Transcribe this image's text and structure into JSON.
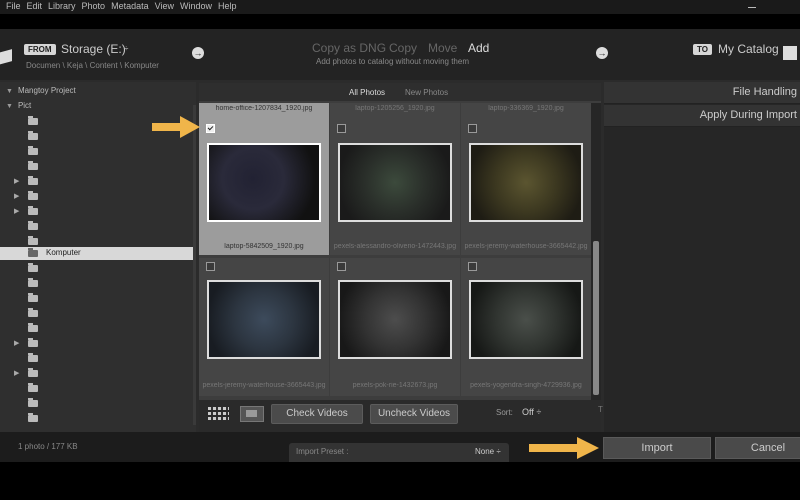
{
  "menu": [
    "File",
    "Edit",
    "Library",
    "Photo",
    "Metadata",
    "View",
    "Window",
    "Help"
  ],
  "source": {
    "badge": "FROM",
    "title": "Storage (E:)",
    "updown": "÷",
    "path": "Documen \\ Keja \\ Content \\ Komputer"
  },
  "modes": {
    "items": [
      "Copy as DNG",
      "Copy",
      "Move",
      "Add"
    ],
    "active": "Add",
    "subtitle": "Add photos to catalog without moving them"
  },
  "destination": {
    "badge": "TO",
    "title": "My Catalog"
  },
  "nav_arrow": "→",
  "tree": {
    "project": "Mangtoy Project",
    "root": "Pict",
    "selected_label": "Komputer",
    "project_caret": "▼",
    "root_caret": "▼",
    "collapsed_caret": "▶"
  },
  "tabs": [
    "All Photos",
    "New Photos"
  ],
  "tabs_active": "All Photos",
  "top_row_names": [
    "home-office-1207834_1920.jpg",
    "laptop-1205256_1920.jpg",
    "laptop-336369_1920.jpg"
  ],
  "photos": [
    {
      "name": "laptop-5842509_1920.jpg",
      "checked": true,
      "icon": "laptop-photo"
    },
    {
      "name": "pexels-alessandro-oliverio-1472443.jpg",
      "checked": false,
      "icon": "raspberry-pi-photo"
    },
    {
      "name": "pexels-jeremy-waterhouse-3665442.jpg",
      "checked": false,
      "icon": "circuit-board-photo"
    },
    {
      "name": "pexels-jeremy-waterhouse-3665443.jpg",
      "checked": false,
      "icon": "motherboard-photo"
    },
    {
      "name": "pexels-pok-rie-1432673.jpg",
      "checked": false,
      "icon": "chip-photo"
    },
    {
      "name": "pexels-yogendra-singh-4729936.jpg",
      "checked": false,
      "icon": "cpu-socket-photo"
    }
  ],
  "toolbar": {
    "check_videos": "Check Videos",
    "uncheck_videos": "Uncheck Videos",
    "sort_label": "Sort:",
    "sort_value": "Off ÷",
    "t_mark": "T"
  },
  "right_panel": {
    "file_handling": "File Handling",
    "apply_during_import": "Apply During Import"
  },
  "bottom": {
    "status": "1 photo / 177 KB",
    "preset_label": "Import Preset :",
    "preset_value": "None ÷",
    "import": "Import",
    "cancel": "Cancel"
  },
  "colors": {
    "callout_arrow": "#f0b54a",
    "selection": "#d8d8d8"
  }
}
